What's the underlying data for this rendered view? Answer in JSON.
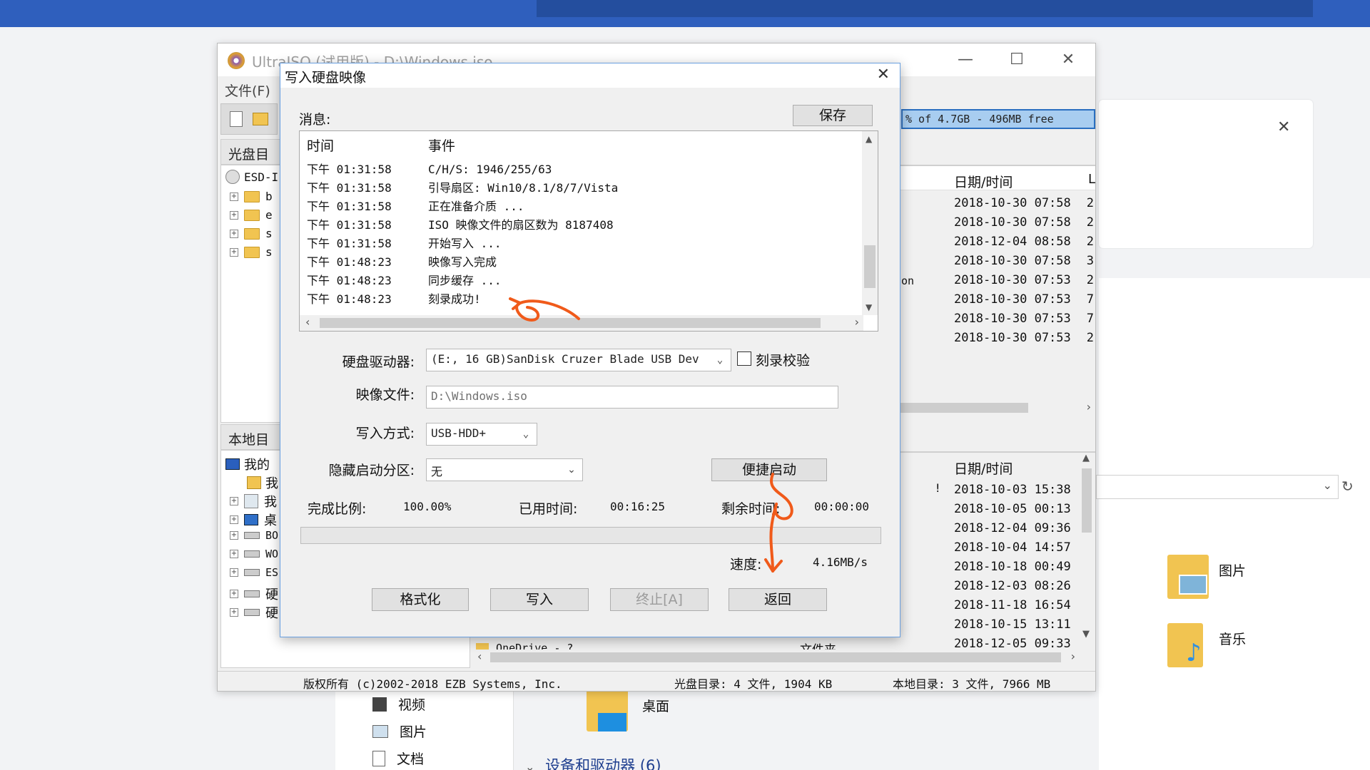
{
  "background": {
    "explorer_items": [
      {
        "label": "图片",
        "icon": "pictures-folder-icon"
      },
      {
        "label": "音乐",
        "icon": "music-folder-icon"
      }
    ],
    "nav_items": [
      {
        "label": "视频",
        "icon": "video-icon"
      },
      {
        "label": "图片",
        "icon": "pictures-icon"
      },
      {
        "label": "文档",
        "icon": "documents-icon"
      }
    ],
    "desktop_label": "桌面",
    "devices_header": "设备和驱动器 (6)",
    "close_glyph": "✕"
  },
  "ultraiso": {
    "title": "UltraISO (试用版) - D:\\Windows.iso",
    "menu_file": "文件(F)",
    "cd_dir_label": "光盘目录",
    "local_dir_label": "本地目录",
    "capacity_text": "% of 4.7GB - 496MB free",
    "iso_root": "ESD-I",
    "cd_tree": [
      "b",
      "e",
      "s",
      "s"
    ],
    "local_root": "我的",
    "local_tree": [
      "我",
      "我",
      "桌",
      "BO",
      "WO",
      "ES",
      "硬",
      "硬"
    ],
    "top_list": {
      "header_date": "日期/时间",
      "header_l": "L",
      "partial_text": "on",
      "rows": [
        {
          "date": "2018-10-30 07:58",
          "l": "2"
        },
        {
          "date": "2018-10-30 07:58",
          "l": "2"
        },
        {
          "date": "2018-12-04 08:58",
          "l": "2"
        },
        {
          "date": "2018-10-30 07:58",
          "l": "3"
        },
        {
          "date": "2018-10-30 07:53",
          "l": "2"
        },
        {
          "date": "2018-10-30 07:53",
          "l": "7"
        },
        {
          "date": "2018-10-30 07:53",
          "l": "7"
        },
        {
          "date": "2018-10-30 07:53",
          "l": "2"
        }
      ]
    },
    "bottom_list": {
      "header_date": "日期/时间",
      "mark": "!",
      "rows": [
        "2018-10-03 15:38",
        "2018-10-05 00:13",
        "2018-12-04 09:36",
        "2018-10-04 14:57",
        "2018-10-18 00:49",
        "2018-12-03 08:26",
        "2018-11-18 16:54",
        "2018-10-15 13:11",
        "2018-12-05 09:33"
      ],
      "partial_name": "OneDrive - ?",
      "partial_type": "文件夹"
    },
    "status": {
      "copyright": "版权所有 (c)2002-2018 EZB Systems, Inc.",
      "cd_info": "光盘目录: 4 文件, 1904 KB",
      "local_info": "本地目录: 3 文件, 7966 MB"
    }
  },
  "dialog": {
    "title": "写入硬盘映像",
    "messages_label": "消息:",
    "save_label": "保存",
    "log_headers": {
      "time": "时间",
      "event": "事件"
    },
    "log": [
      {
        "time": "下午 01:31:58",
        "event": "C/H/S: 1946/255/63"
      },
      {
        "time": "下午 01:31:58",
        "event": "引导扇区: Win10/8.1/8/7/Vista"
      },
      {
        "time": "下午 01:31:58",
        "event": "正在准备介质 ..."
      },
      {
        "time": "下午 01:31:58",
        "event": "ISO 映像文件的扇区数为 8187408"
      },
      {
        "time": "下午 01:31:58",
        "event": "开始写入 ..."
      },
      {
        "time": "下午 01:48:23",
        "event": "映像写入完成"
      },
      {
        "time": "下午 01:48:23",
        "event": "同步缓存 ..."
      },
      {
        "time": "下午 01:48:23",
        "event": "刻录成功!"
      }
    ],
    "drive_label": "硬盘驱动器:",
    "drive_value": "(E:, 16 GB)SanDisk Cruzer Blade USB Dev",
    "verify_label": "刻录校验",
    "verify_checked": false,
    "image_label": "映像文件:",
    "image_value": "D:\\Windows.iso",
    "method_label": "写入方式:",
    "method_value": "USB-HDD+",
    "hide_label": "隐藏启动分区:",
    "hide_value": "无",
    "quick_boot_label": "便捷启动",
    "progress_label": "完成比例:",
    "progress_value": "100.00%",
    "progress_fraction": 1.0,
    "elapsed_label": "已用时间:",
    "elapsed_value": "00:16:25",
    "remaining_label": "剩余时间:",
    "remaining_value": "00:00:00",
    "speed_label": "速度:",
    "speed_value": "4.16MB/s",
    "buttons": {
      "format": "格式化",
      "write": "写入",
      "abort": "终止[A]",
      "back": "返回"
    },
    "close_glyph": "✕",
    "annotation_color": "#f05a1a"
  }
}
